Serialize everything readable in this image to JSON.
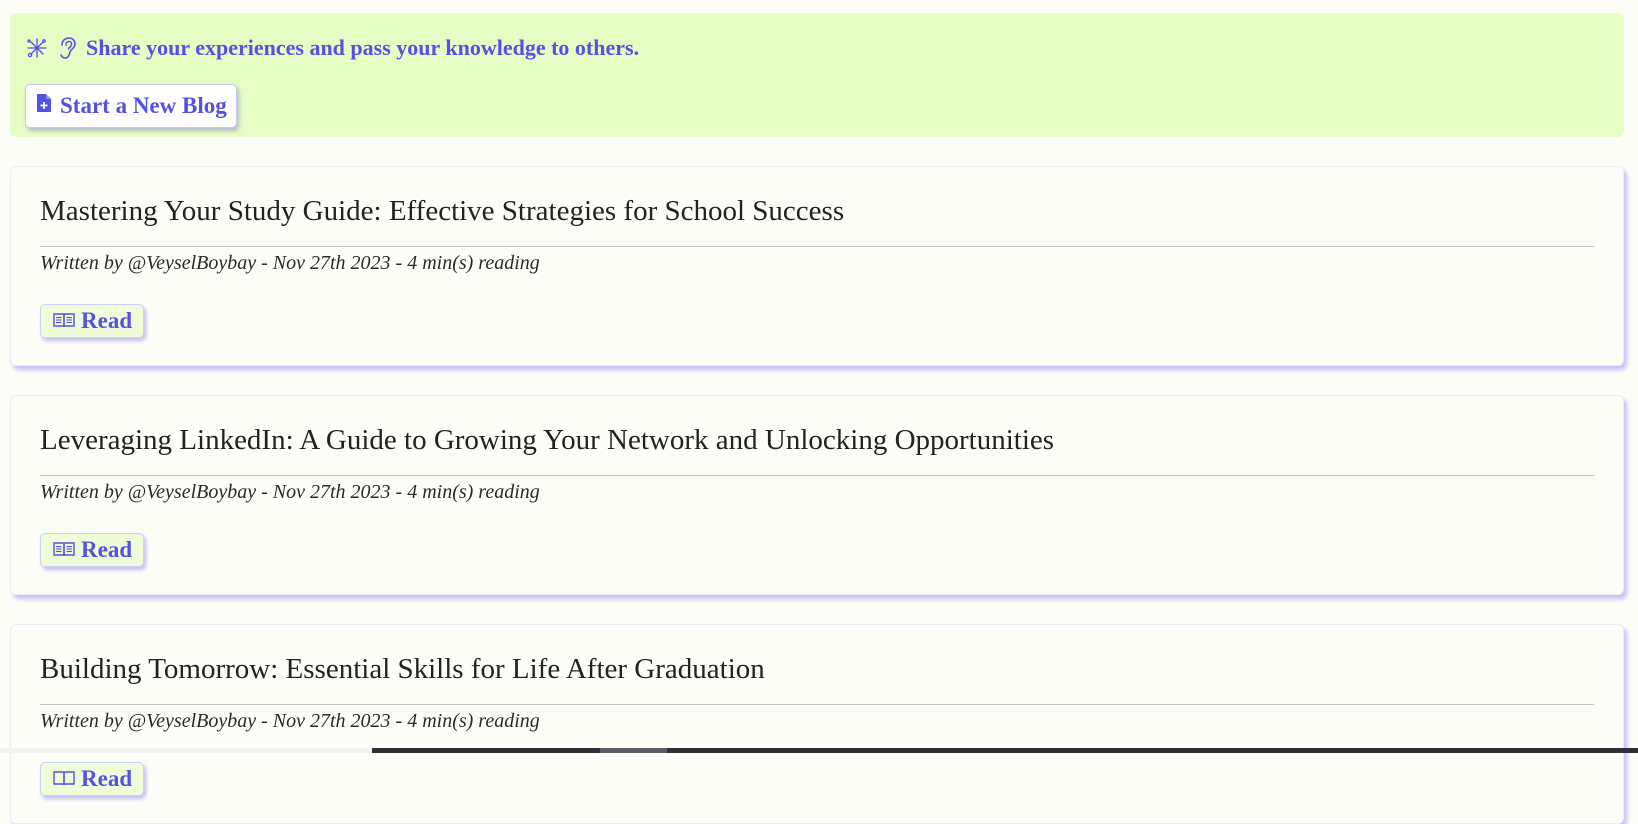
{
  "banner": {
    "message": "Share your experiences and pass your knowledge to others.",
    "sparkle_icon": "sparkles-icon",
    "ear_icon": "ear-icon",
    "new_blog_label": "Start a New Blog",
    "new_blog_icon": "file-plus-icon",
    "accent_color": "#5451e6",
    "background_color": "#e6fdc3"
  },
  "posts": [
    {
      "title": "Mastering Your Study Guide: Effective Strategies for School Success",
      "meta": "Written by @VeyselBoybay - Nov 27th 2023 - 4 min(s) reading",
      "read_label": "Read"
    },
    {
      "title": "Leveraging LinkedIn: A Guide to Growing Your Network and Unlocking Opportunities",
      "meta": "Written by @VeyselBoybay - Nov 27th 2023 - 4 min(s) reading",
      "read_label": "Read"
    },
    {
      "title": "Building Tomorrow: Essential Skills for Life After Graduation",
      "meta": "Written by @VeyselBoybay - Nov 27th 2023 - 4 min(s) reading",
      "read_label": "Read"
    }
  ],
  "read_icon": "open-book-icon"
}
